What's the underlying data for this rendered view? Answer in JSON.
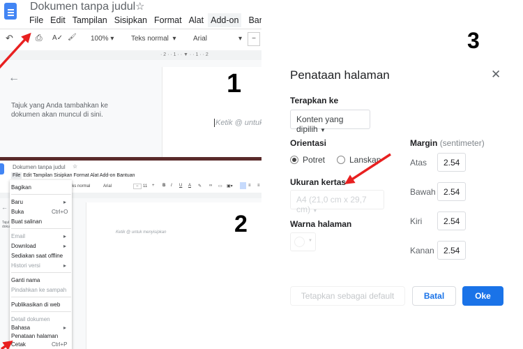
{
  "panel1": {
    "doc_title": "Dokumen tanpa judul",
    "menu": [
      "File",
      "Edit",
      "Tampilan",
      "Sisipkan",
      "Format",
      "Alat",
      "Add-on",
      "Bantuan"
    ],
    "zoom": "100%",
    "style": "Teks normal",
    "font": "Arial",
    "ruler": "· 2 · · 1 · · ▼ · · 1 · · 2",
    "outline_hint": "Tajuk yang Anda tambahkan ke dokumen akan muncul di sini.",
    "placeholder": "Ketik @ untuk",
    "step_number": "1"
  },
  "panel2": {
    "doc_title": "Dokumen tanpa judul",
    "menu": [
      "File",
      "Edit",
      "Tampilan",
      "Sisipkan",
      "Format",
      "Alat",
      "Add-on",
      "Bantuan"
    ],
    "style": "eks normal",
    "font": "Arial",
    "font_size": "11",
    "outline_hint": "Tajul doku",
    "placeholder": "Ketik @ untuk menyisipkan",
    "step_number": "2",
    "file_menu": [
      {
        "label": "Bagikan"
      },
      {
        "label": "Baru",
        "submenu": true
      },
      {
        "label": "Buka",
        "shortcut": "Ctrl+O"
      },
      {
        "label": "Buat salinan"
      },
      {
        "label": "Email",
        "submenu": true,
        "disabled": true
      },
      {
        "label": "Download",
        "submenu": true
      },
      {
        "label": "Sediakan saat offline"
      },
      {
        "label": "Histori versi",
        "submenu": true,
        "disabled": true
      },
      {
        "label": "Ganti nama"
      },
      {
        "label": "Pindahkan ke sampah",
        "disabled": true
      },
      {
        "label": "Publikasikan di web"
      },
      {
        "label": "Detail dokumen",
        "disabled": true
      },
      {
        "label": "Bahasa",
        "submenu": true
      },
      {
        "label": "Penataan halaman"
      },
      {
        "label": "Cetak",
        "shortcut": "Ctrl+P"
      }
    ]
  },
  "dialog": {
    "step_number": "3",
    "title": "Penataan halaman",
    "apply_label": "Terapkan ke",
    "apply_value": "Konten yang dipilih",
    "orientation_label": "Orientasi",
    "portrait": "Potret",
    "landscape": "Lanskap",
    "orientation_selected": "Potret",
    "paper_label": "Ukuran kertas",
    "paper_value": "A4 (21,0 cm x 29,7 cm)",
    "color_label": "Warna halaman",
    "margin_label": "Margin",
    "margin_unit": "(sentimeter)",
    "margins": [
      {
        "label": "Atas",
        "value": "2.54"
      },
      {
        "label": "Bawah",
        "value": "2.54"
      },
      {
        "label": "Kiri",
        "value": "2.54"
      },
      {
        "label": "Kanan",
        "value": "2.54"
      }
    ],
    "default_btn": "Tetapkan sebagai default",
    "cancel_btn": "Batal",
    "ok_btn": "Oke"
  },
  "colors": {
    "accent": "#1a73e8",
    "arrow": "#e82020"
  }
}
